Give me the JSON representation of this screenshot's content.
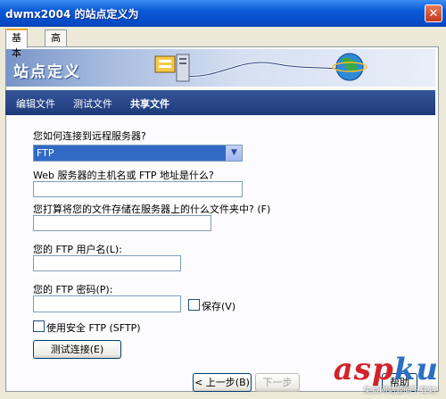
{
  "window": {
    "title": "dwmx2004 的站点定义为",
    "close_label": "✕"
  },
  "tabs": [
    {
      "label": "基本"
    },
    {
      "label": "高级"
    }
  ],
  "banner": {
    "title": "站点定义"
  },
  "nav": {
    "items": [
      "编辑文件",
      "测试文件",
      "共享文件"
    ]
  },
  "form": {
    "connect_label": "您如何连接到远程服务器?",
    "connect_value": "FTP",
    "host_label": "Web 服务器的主机名或 FTP 地址是什么?",
    "host_value": "",
    "folder_label": "您打算将您的文件存储在服务器上的什么文件夹中? (F)",
    "folder_value": "",
    "user_label": "您的 FTP 用户名(L):",
    "user_value": "",
    "password_label": "您的 FTP 密码(P):",
    "password_value": "",
    "save_label": "保存(V)",
    "sftp_label": "使用安全 FTP (SFTP)",
    "test_button": "测试连接(E)"
  },
  "footer": {
    "back_button": "< 上一步(B)",
    "next_button": "下一步",
    "help_button": "帮助"
  },
  "watermark": {
    "asp": "asp",
    "ku": "ku",
    "sub": "免费网站源码下载站!"
  }
}
